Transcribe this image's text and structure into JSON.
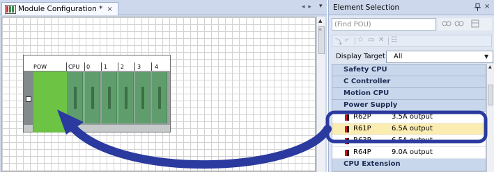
{
  "document": {
    "tab_label": "Module Configuration *",
    "tab_close": "×",
    "nav_arrows": "◂ ▸",
    "menu_caret": "▾",
    "base_unit": {
      "slot_labels": [
        "POW",
        "CPU",
        "0",
        "1",
        "2",
        "3",
        "4"
      ]
    }
  },
  "element_selection": {
    "title": "Element Selection",
    "pin": "ꟸ",
    "close": "×",
    "search": {
      "placeholder": "(Find POU)",
      "value": ""
    },
    "display_target": {
      "label": "Display Target:",
      "value": "All"
    },
    "list": [
      {
        "kind": "category",
        "label": "Safety CPU"
      },
      {
        "kind": "category",
        "label": "C Controller"
      },
      {
        "kind": "category",
        "label": "Motion CPU"
      },
      {
        "kind": "category",
        "label": "Power Supply"
      },
      {
        "kind": "item",
        "model": "R62P",
        "desc": "3.5A output"
      },
      {
        "kind": "item",
        "model": "R61P",
        "desc": "6.5A output",
        "selected": true
      },
      {
        "kind": "item",
        "model": "R63P",
        "desc": "6.5A output"
      },
      {
        "kind": "item",
        "model": "R64P",
        "desc": "9.0A output"
      },
      {
        "kind": "category",
        "label": "CPU Extension"
      }
    ]
  },
  "colors": {
    "power_module": "#6cc344",
    "slot_green": "#5f9e6c",
    "highlight": "#fbedb1",
    "annotation": "#2b3a9e"
  }
}
